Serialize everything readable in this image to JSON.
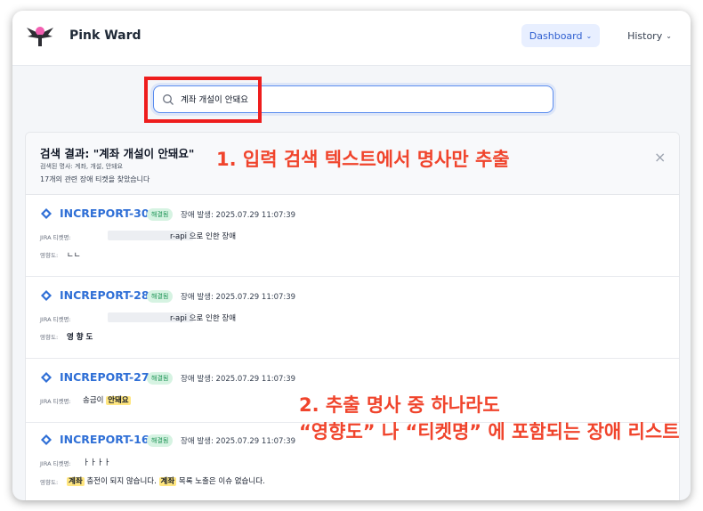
{
  "app": {
    "brand": "Pink Ward"
  },
  "nav": {
    "dashboard": "Dashboard",
    "history": "History"
  },
  "search": {
    "value": "계좌 개설이 안돼요",
    "placeholder": ""
  },
  "results": {
    "title": "검색 결과: \"계좌 개설이 안돼요\"",
    "nouns": "검색된 명사: 계좌, 개설, 안돼요",
    "count": "17개의 관련 장애 티켓을 찾았습니다"
  },
  "annotations": {
    "step1": "1. 입력 검색 텍스트에서 명사만 추출",
    "step2_line1": "2. 추출 명사 중 하나라도",
    "step2_line2": "“영향도” 나 “티켓명” 에 포함되는 장애 리스트"
  },
  "labels": {
    "jira_ticket": "JIRA 티켓명:",
    "impact": "영향도:"
  },
  "items": [
    {
      "id": "INCREPORT-303",
      "status": "해결됨",
      "occurred": "장애 발생: 2025.07.29 11:07:39",
      "ticket_name_visible": "r-api 으로 인한 장애",
      "impact": "ㄴㄴ"
    },
    {
      "id": "INCREPORT-284",
      "status": "해결됨",
      "occurred": "장애 발생: 2025.07.29 11:07:39",
      "ticket_name_visible": "r-api 으로 인한 장애",
      "impact": "영 향 도"
    },
    {
      "id": "INCREPORT-277",
      "status": "해결됨",
      "occurred": "장애 발생: 2025.07.29 11:07:39",
      "ticket_name_pre": "송금이",
      "ticket_name_hl": "안돼요"
    },
    {
      "id": "INCREPORT-162",
      "status": "해결됨",
      "occurred": "장애 발생: 2025.07.29 11:07:39",
      "ticket_name_visible": "ㅏㅏㅏㅏ",
      "impact_hl1": "계좌",
      "impact_mid": "충전이 되지 않습니다.",
      "impact_hl2": "계좌",
      "impact_end": "목록 노출은 이슈 없습니다."
    }
  ],
  "colors": {
    "accent": "#2f6fd6",
    "annotation": "#f0442c",
    "badge_bg": "#d6f3e2",
    "highlight": "#ffe680"
  }
}
